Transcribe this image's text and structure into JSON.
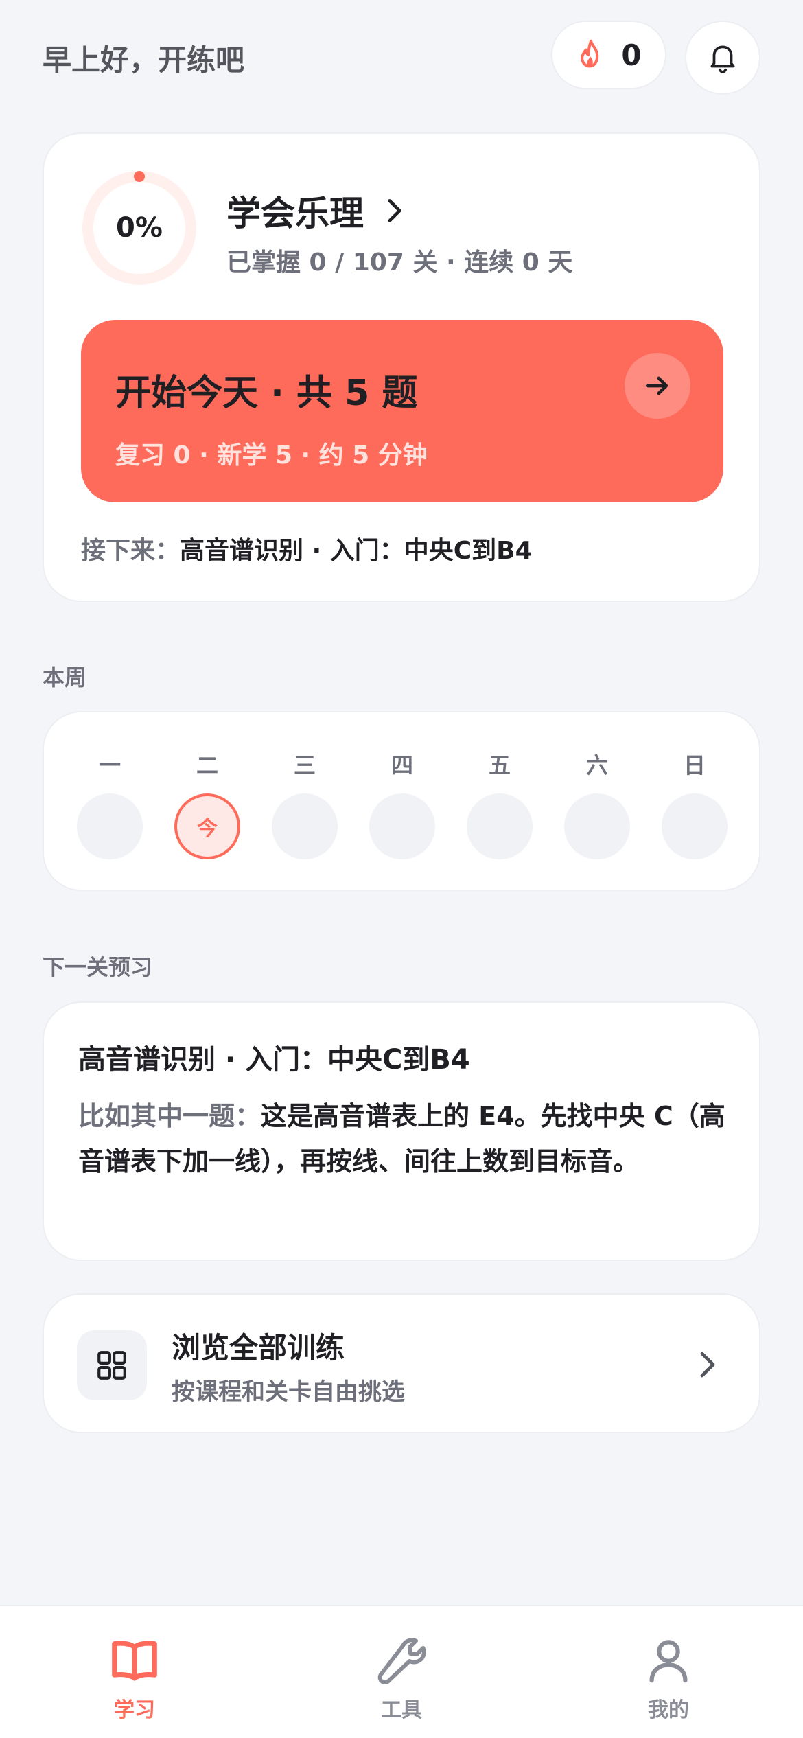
{
  "header": {
    "greeting": "早上好，开练吧",
    "streak_count": "0",
    "icons": {
      "streak": "flame-icon",
      "notifications": "bell-icon"
    }
  },
  "course": {
    "progress_percent": 0,
    "progress_label": "0%",
    "title": "学会乐理",
    "subtitle": "已掌握 0 / 107 关 · 连续 0 天",
    "start": {
      "title": "开始今天 · 共 5 题",
      "subtitle": "复习 0 · 新学 5 · 约 5 分钟"
    },
    "next": {
      "label": "接下来：",
      "value": "高音谱识别 · 入门：中央C到B4"
    }
  },
  "week": {
    "section_label": "本周",
    "days": [
      {
        "label": "一",
        "mark": ""
      },
      {
        "label": "二",
        "mark": "今"
      },
      {
        "label": "三",
        "mark": ""
      },
      {
        "label": "四",
        "mark": ""
      },
      {
        "label": "五",
        "mark": ""
      },
      {
        "label": "六",
        "mark": ""
      },
      {
        "label": "日",
        "mark": ""
      }
    ]
  },
  "preview": {
    "section_label": "下一关预习",
    "title": "高音谱识别 · 入门：中央C到B4",
    "example_prefix": "比如其中一题：",
    "example_text": "这是高音谱表上的 E4。先找中央 C（高音谱表下加一线），再按线、间往上数到目标音。"
  },
  "browse": {
    "title": "浏览全部训练",
    "subtitle": "按课程和关卡自由挑选"
  },
  "tabs": [
    {
      "label": "学习",
      "icon": "book-icon",
      "active": true
    },
    {
      "label": "工具",
      "icon": "wrench-icon",
      "active": false
    },
    {
      "label": "我的",
      "icon": "user-icon",
      "active": false
    }
  ],
  "colors": {
    "accent": "#ff6b5b",
    "accent_light": "#ffe9e6",
    "background": "#f4f5f8",
    "muted_text": "#6d707a"
  }
}
